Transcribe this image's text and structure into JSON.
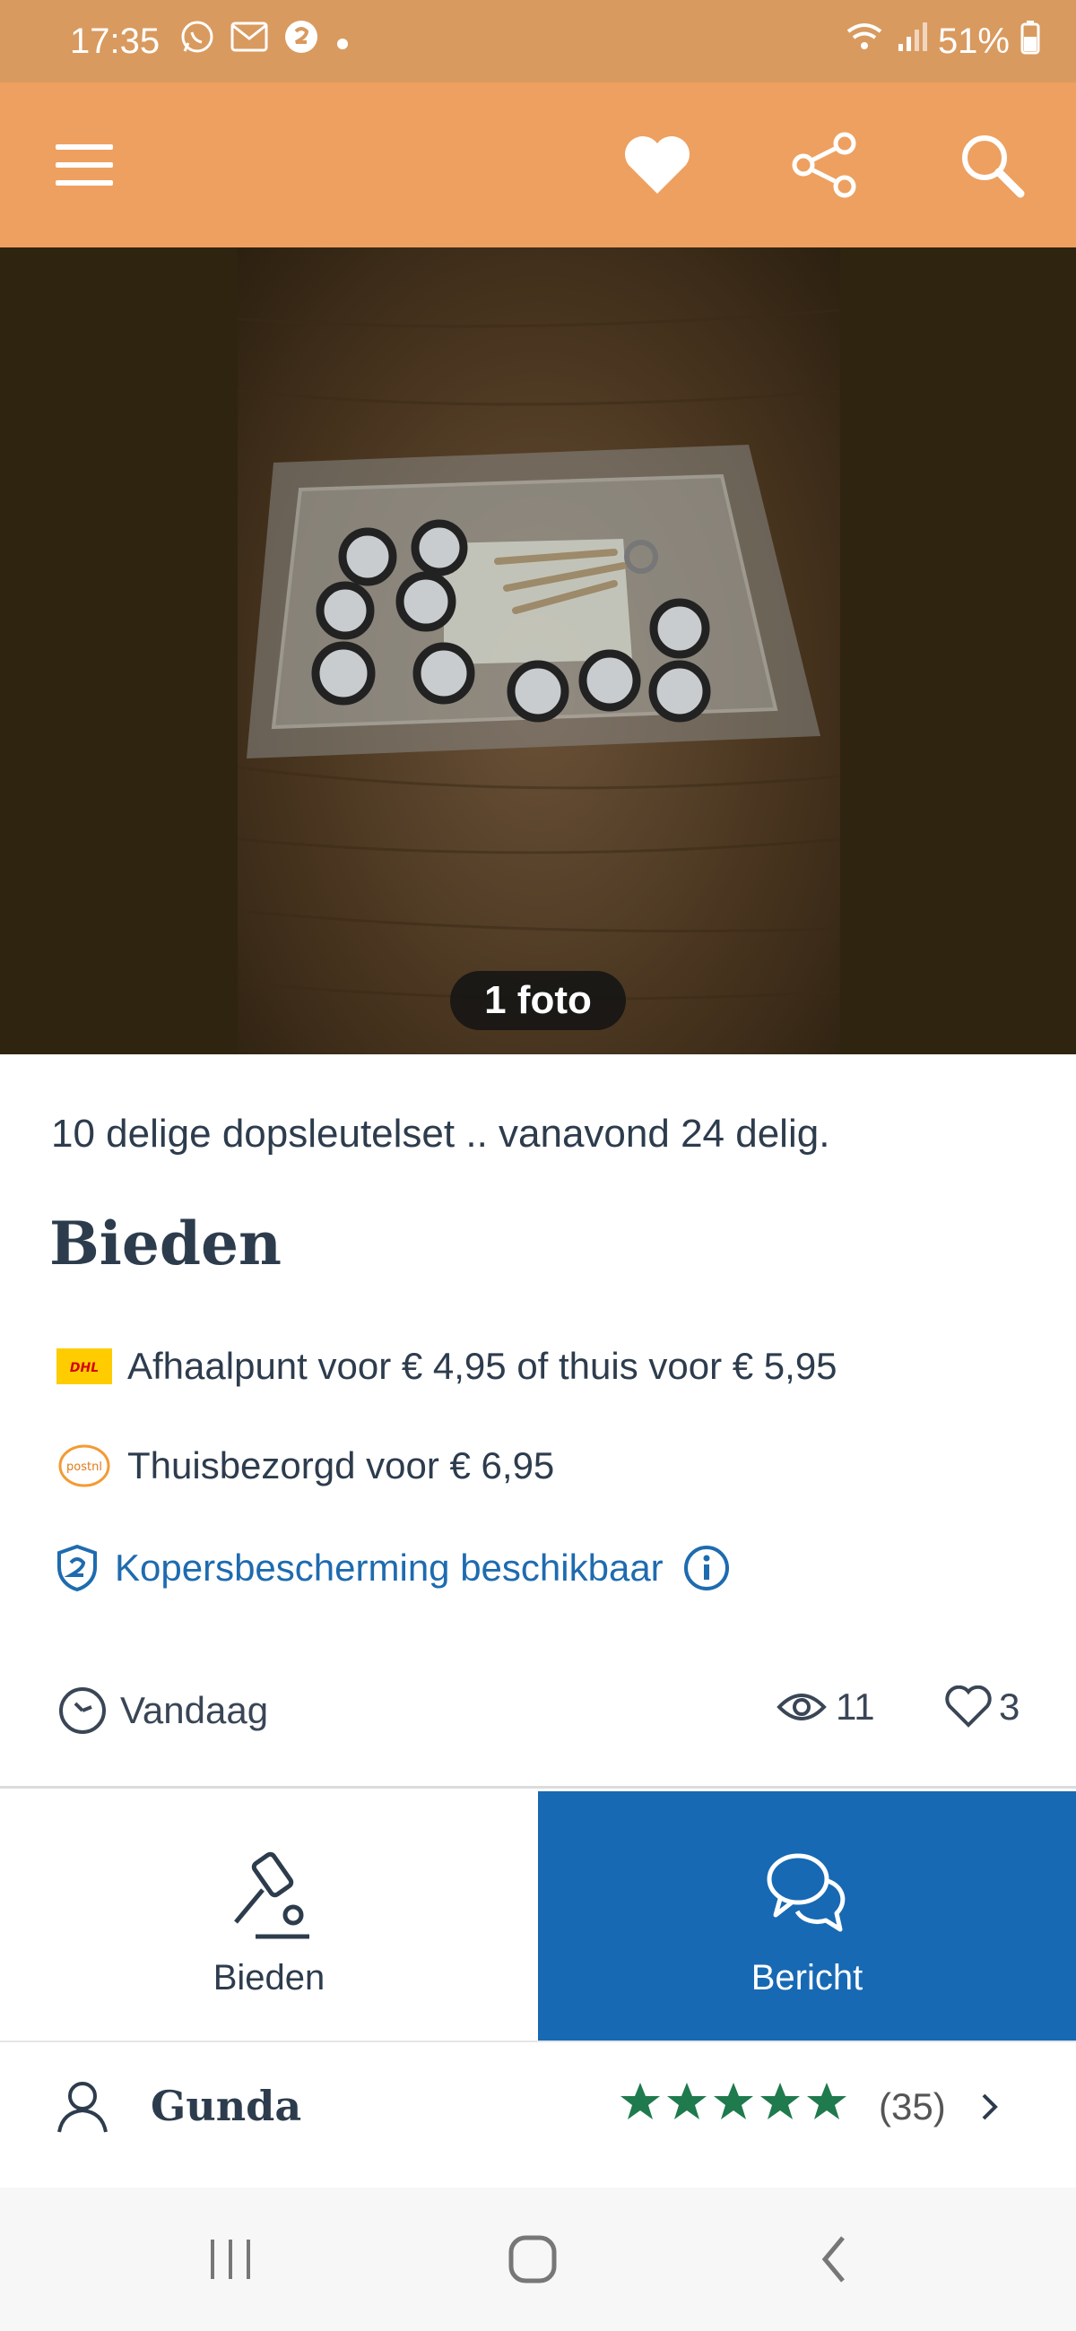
{
  "status_bar": {
    "time": "17:35",
    "battery": "51%",
    "icons": [
      "whatsapp-icon",
      "gmail-icon",
      "marktplaats-badge-icon",
      "notification-dot-icon",
      "wifi-icon",
      "signal-icon",
      "battery-icon"
    ]
  },
  "toolbar": {
    "menu_icon": "hamburger-menu-icon",
    "favorite_icon": "heart-icon",
    "share_icon": "share-icon",
    "search_icon": "search-icon"
  },
  "photo": {
    "count_label": "1 foto"
  },
  "listing": {
    "title": "10 delige dopsleutelset .. vanavond 24 delig.",
    "price_type": "Bieden",
    "shipping": [
      {
        "carrier_logo": "DHL",
        "text": "Afhaalpunt voor € 4,95 of thuis voor € 5,95"
      },
      {
        "carrier_logo": "postnl",
        "text": "Thuisbezorgd voor € 6,95"
      }
    ],
    "buyer_protection": "Kopersbescherming beschikbaar",
    "posted": "Vandaag",
    "views": "11",
    "favorites": "3"
  },
  "actions": {
    "bid_label": "Bieden",
    "message_label": "Bericht"
  },
  "seller": {
    "name": "Gunda",
    "rating_stars": 5,
    "reviews": "(35)"
  },
  "colors": {
    "status_bar": "#d99a5f",
    "toolbar": "#eda060",
    "accent_blue": "#1769b4",
    "text_dark": "#2d3c4d",
    "star_green": "#1f7a4d"
  }
}
